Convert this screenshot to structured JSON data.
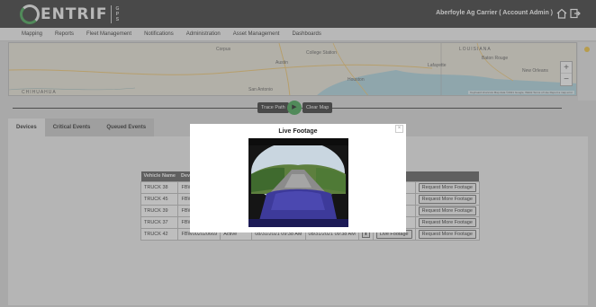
{
  "header": {
    "logo_text": "ENTRIF",
    "logo_gps": "GPS",
    "account": "Aberfoyle Ag Carrier ( Account Admin )"
  },
  "nav": [
    "Mapping",
    "Reports",
    "Fleet Management",
    "Notifications",
    "Administration",
    "Asset Management",
    "Dashboards"
  ],
  "map": {
    "labels": [
      "Austin",
      "San Antonio",
      "Houston",
      "LOUISIANA",
      "Baton Rouge",
      "New Orleans",
      "College Station",
      "Lafayette",
      "CHIHUAHUA",
      "Corpus"
    ],
    "zoom_in": "+",
    "zoom_out": "−",
    "attribution": "Keyboard shortcuts   Map data ©2021 Google, INEGI   Terms of Use   Report a map error"
  },
  "controls": {
    "trace_path": "Trace Path",
    "clear_map": "Clear Map",
    "play_icon": "▶"
  },
  "tabs": [
    "Devices",
    "Critical Events",
    "Queued Events"
  ],
  "table": {
    "headers": [
      "Vehicle Name",
      "Devi"
    ],
    "rows": [
      {
        "vehicle": "TRUCK 38",
        "device": "FBW"
      },
      {
        "vehicle": "TRUCK 45",
        "device": "FBW"
      },
      {
        "vehicle": "TRUCK 39",
        "device": "FBW"
      },
      {
        "vehicle": "TRUCK 37",
        "device": "FBW"
      },
      {
        "vehicle": "TRUCK 42",
        "device": "FBW002020669",
        "status": "Active",
        "first": "08/31/2021 09:38 AM",
        "last": "08/31/2021 09:38 AM"
      }
    ],
    "live_label": "Live Footage",
    "request_label": "Request More Footage",
    "download_icon": "⬇"
  },
  "modal": {
    "title": "Live Footage",
    "close": "×"
  }
}
